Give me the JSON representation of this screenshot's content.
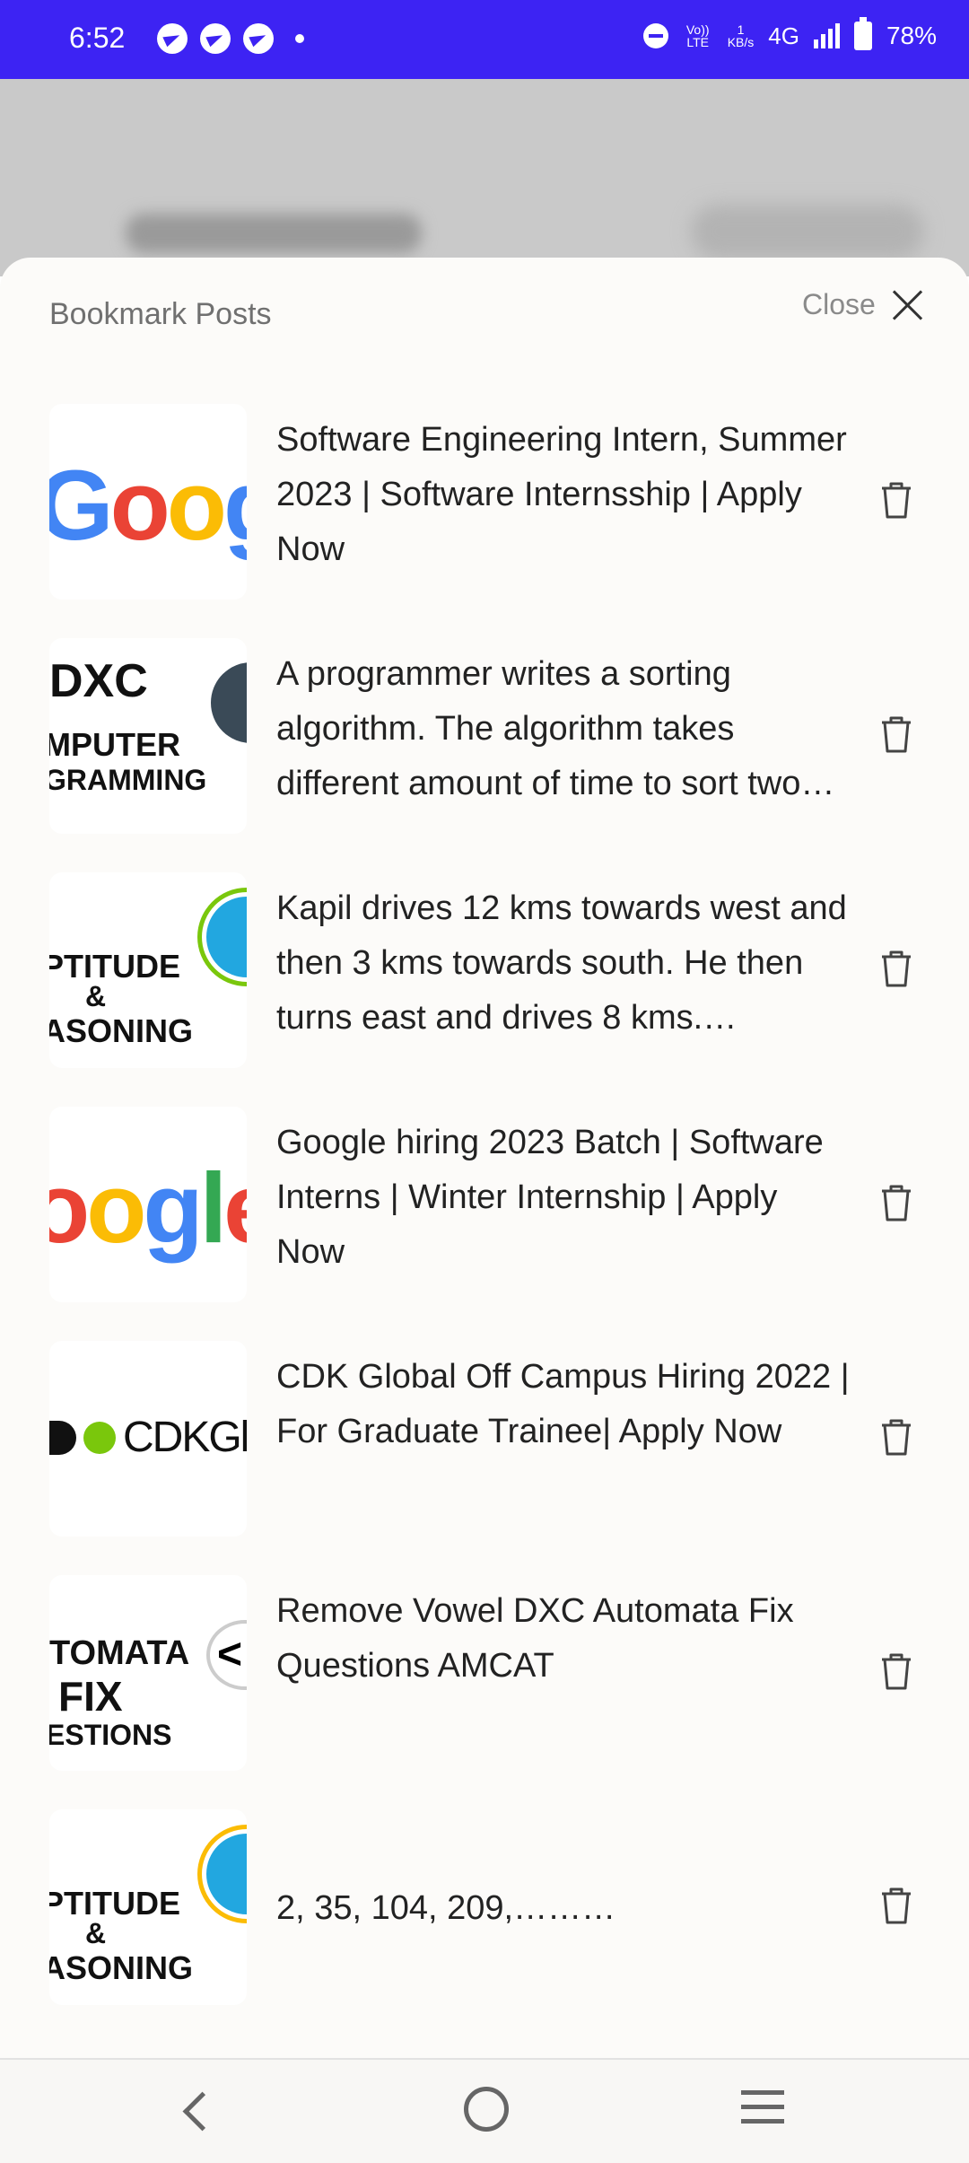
{
  "status_bar": {
    "time": "6:52",
    "network": "4G",
    "speed_value": "1",
    "speed_unit": "KB/s",
    "volte": "Vo)) LTE",
    "battery": "78%"
  },
  "sheet": {
    "title": "Bookmark Posts",
    "close_label": "Close"
  },
  "bookmarks": [
    {
      "text": "Software Engineering Intern, Summer 2023 | Software Internsship | Apply Now",
      "thumb": "Goog"
    },
    {
      "text": "A programmer writes a sorting algorithm. The algorithm takes different amount of time to sort two input lists of the same size.",
      "thumb_lines": [
        "DXC",
        "MPUTER",
        "GRAMMING"
      ]
    },
    {
      "text": "Kapil drives 12 kms towards west and then 3 kms towards south. He then turns east and drives 8 kms.…",
      "thumb_lines": [
        "PTITUDE",
        "&",
        "ASONING"
      ]
    },
    {
      "text": "Google hiring 2023 Batch | Software Interns | Winter Internship | Apply Now",
      "thumb": "oogle"
    },
    {
      "text": "CDK Global Off Campus Hiring 2022 | For Graduate Trainee| Apply Now",
      "thumb": "CDKGl"
    },
    {
      "text": "Remove Vowel DXC Automata Fix Questions AMCAT",
      "thumb_lines": [
        "TOMATA",
        "FIX",
        "ESTIONS"
      ]
    },
    {
      "text": "2, 35, 104, 209,………",
      "thumb_lines": [
        "PTITUDE",
        "&",
        "ASONING"
      ]
    }
  ],
  "icons": {
    "delete": "trash-icon",
    "close": "close-icon"
  },
  "colors": {
    "status_bar": "#3d23f3",
    "sheet_bg": "#fcfbf9"
  }
}
